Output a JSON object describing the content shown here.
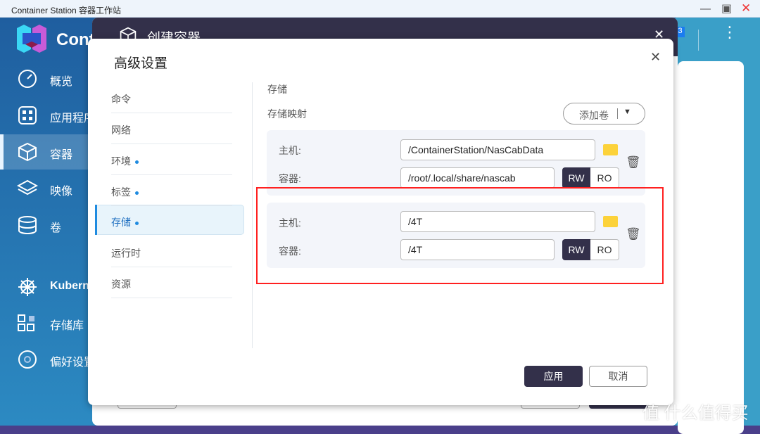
{
  "window": {
    "title": "Container Station 容器工作站"
  },
  "sidebar": {
    "app_name": "Cont",
    "items": [
      {
        "label": "概览",
        "icon": "gauge-icon"
      },
      {
        "label": "应用程序",
        "icon": "apps-icon"
      },
      {
        "label": "容器",
        "icon": "cube-icon",
        "selected": true
      },
      {
        "label": "映像",
        "icon": "layers-icon"
      },
      {
        "label": "卷",
        "icon": "database-icon"
      },
      {
        "label": "Kubernetes",
        "icon": "helm-icon"
      },
      {
        "label": "存储库",
        "icon": "repository-icon"
      },
      {
        "label": "偏好设置",
        "icon": "gear-icon"
      }
    ]
  },
  "header": {
    "badge": "3"
  },
  "back_dialog": {
    "title": "创建容器"
  },
  "dialog": {
    "title": "高级设置",
    "nav": [
      {
        "label": "命令",
        "dot": false
      },
      {
        "label": "网络",
        "dot": false
      },
      {
        "label": "环境",
        "dot": true
      },
      {
        "label": "标签",
        "dot": true
      },
      {
        "label": "存储",
        "dot": true,
        "selected": true
      },
      {
        "label": "运行时",
        "dot": false
      },
      {
        "label": "资源",
        "dot": false
      }
    ],
    "section_title": "存储",
    "mapping_label": "存储映射",
    "add_volume": "添加卷",
    "host_label": "主机:",
    "container_label": "容器:",
    "rw": "RW",
    "ro": "RO",
    "mappings": [
      {
        "host": "/ContainerStation/NasCabData",
        "container": "/root/.local/share/nascab",
        "mode": "RW"
      },
      {
        "host": "/4T",
        "container": "/4T",
        "mode": "RW"
      }
    ],
    "apply": "应用",
    "cancel": "取消"
  },
  "colors": {
    "accent": "#33304a",
    "highlight": "#ff2020",
    "folder": "#fcd23a"
  },
  "watermark": "值 什么值得买"
}
